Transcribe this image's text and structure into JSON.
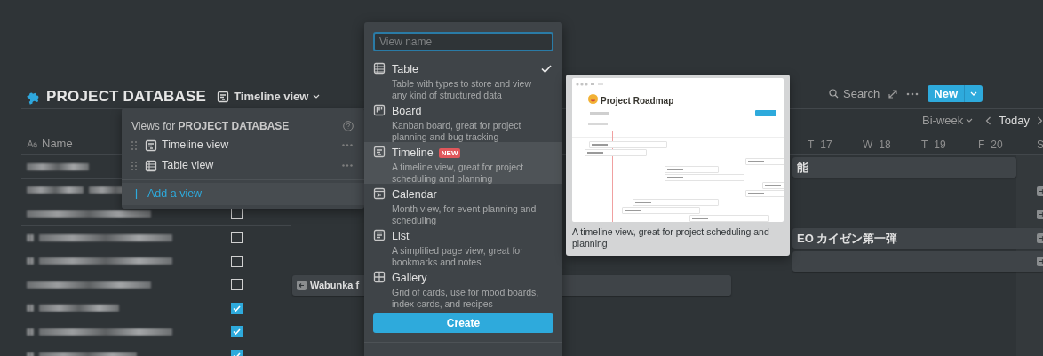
{
  "header": {
    "title": "PROJECT DATABASE",
    "view_switch": "Timeline view"
  },
  "actions": {
    "search": "Search",
    "new_button": "New"
  },
  "timeline_toolbar": {
    "range": "Bi-week",
    "today": "Today"
  },
  "table": {
    "columns": [
      {
        "label": "Name"
      }
    ],
    "rows": [
      {
        "kind": "covered"
      },
      {
        "kind": "covered"
      },
      {
        "kind": "checkbox",
        "checked": false
      },
      {
        "kind": "checkbox",
        "checked": false
      },
      {
        "kind": "checkbox",
        "checked": false
      },
      {
        "kind": "checkbox",
        "checked": false
      },
      {
        "kind": "checkbox",
        "checked": true
      },
      {
        "kind": "checkbox",
        "checked": true
      },
      {
        "kind": "checkbox",
        "checked": true
      }
    ]
  },
  "timeline": {
    "days": [
      {
        "weekday": "T",
        "date": "17"
      },
      {
        "weekday": "W",
        "date": "18"
      },
      {
        "weekday": "T",
        "date": "19"
      },
      {
        "weekday": "F",
        "date": "20"
      },
      {
        "weekday": "S"
      }
    ],
    "rows": [
      {
        "bar": true,
        "label": "能"
      },
      {
        "arrow_right": true
      },
      {
        "arrow_right": true
      },
      {
        "bar": true,
        "label": "EO カイゼン第一弾",
        "arrow_right": true
      },
      {
        "bar": true,
        "arrow_right": true
      },
      {
        "bar": true,
        "label": "Wabunka f",
        "arrow_left": true
      }
    ]
  },
  "views_popover": {
    "title": "Views for **PROJECT DATABASE**",
    "views": [
      {
        "kind": "timeline",
        "label": "Timeline view"
      },
      {
        "kind": "table",
        "label": "Table view"
      }
    ],
    "add_button": "Add a view"
  },
  "add_view_menu": {
    "placeholder": "View name",
    "options": [
      {
        "kind": "table",
        "label": "Table",
        "description": "Table with types to store and view any kind of structured data",
        "selected": true,
        "highlighted": false
      },
      {
        "kind": "board",
        "label": "Board",
        "description": "Kanban board, great for project planning and bug tracking",
        "selected": false,
        "highlighted": false
      },
      {
        "kind": "timeline",
        "label": "Timeline",
        "badge": "NEW",
        "description": "A timeline view, great for project scheduling and planning",
        "selected": false,
        "highlighted": true
      },
      {
        "kind": "calendar",
        "label": "Calendar",
        "description": "Month view, for event planning and scheduling",
        "selected": false,
        "highlighted": false
      },
      {
        "kind": "list",
        "label": "List",
        "description": "A simplified page view, great for bookmarks and notes",
        "selected": false,
        "highlighted": false
      },
      {
        "kind": "gallery",
        "label": "Gallery",
        "description": "Grid of cards, use for mood boards, index cards, and recipes",
        "selected": false,
        "highlighted": false
      }
    ],
    "create_button": "Create"
  },
  "preview": {
    "title": "Project Roadmap",
    "caption": "A timeline view, great for project scheduling and planning"
  }
}
